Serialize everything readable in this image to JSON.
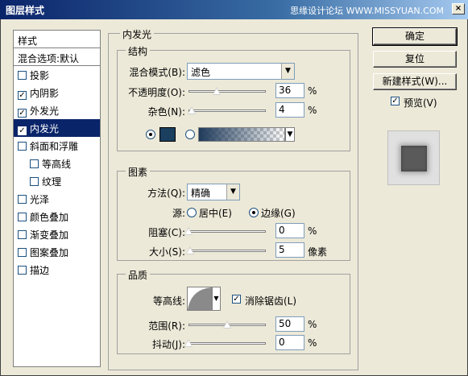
{
  "window": {
    "title": "图层样式",
    "watermark": "思缘设计论坛 WWW.MISSYUAN.COM",
    "close_glyph": "×"
  },
  "styles_panel": {
    "header": "样式",
    "blend_options": "混合选项:默认",
    "items": [
      {
        "label": "投影",
        "checked": false
      },
      {
        "label": "内阴影",
        "checked": true
      },
      {
        "label": "外发光",
        "checked": true
      },
      {
        "label": "内发光",
        "checked": true,
        "selected": true
      },
      {
        "label": "斜面和浮雕",
        "checked": false
      },
      {
        "label": "等高线",
        "checked": false,
        "sub": true
      },
      {
        "label": "纹理",
        "checked": false,
        "sub": true
      },
      {
        "label": "光泽",
        "checked": false
      },
      {
        "label": "颜色叠加",
        "checked": false
      },
      {
        "label": "渐变叠加",
        "checked": false
      },
      {
        "label": "图案叠加",
        "checked": false
      },
      {
        "label": "描边",
        "checked": false
      }
    ]
  },
  "inner_glow": {
    "title": "内发光",
    "structure": {
      "title": "结构",
      "blend_mode_label": "混合模式(B):",
      "blend_mode_value": "滤色",
      "opacity_label": "不透明度(O):",
      "opacity_value": "36",
      "opacity_level": 36,
      "noise_label": "杂色(N):",
      "noise_value": "4",
      "noise_level": 4,
      "percent": "%",
      "color_swatch": "#1B3F5E",
      "color_mode": "solid"
    },
    "elements": {
      "title": "图素",
      "method_label": "方法(Q):",
      "method_value": "精确",
      "source_label": "源:",
      "source_center": "居中(E)",
      "source_edge": "边缘(G)",
      "source_value": "edge",
      "choke_label": "阻塞(C):",
      "choke_value": "0",
      "choke_level": 0,
      "size_label": "大小(S):",
      "size_value": "5",
      "size_level": 2,
      "size_unit": "像素",
      "percent": "%"
    },
    "quality": {
      "title": "品质",
      "contour_label": "等高线:",
      "antialias_label": "消除锯齿(L)",
      "antialias_checked": true,
      "range_label": "范围(R):",
      "range_value": "50",
      "range_level": 50,
      "jitter_label": "抖动(J):",
      "jitter_value": "0",
      "jitter_level": 0,
      "percent": "%"
    }
  },
  "buttons": {
    "ok": "确定",
    "reset": "复位",
    "new_style": "新建样式(W)...",
    "preview_label": "预览(V)",
    "preview_checked": true
  },
  "glyphs": {
    "check": "✓",
    "dropdown": "▼"
  }
}
